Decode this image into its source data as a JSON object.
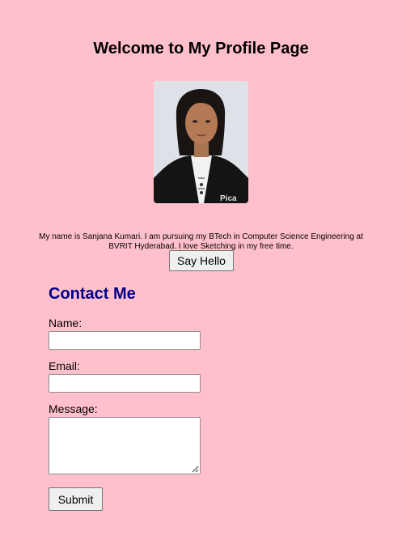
{
  "header": {
    "title": "Welcome to My Profile Page"
  },
  "profile": {
    "photo_alt": "Profile photo",
    "bio": "My name is Sanjana Kumari. I am pursuing my BTech in Computer Science Engineering at BVRIT Hyderabad. I love Sketching in my free time.",
    "say_hello_label": "Say Hello"
  },
  "contact": {
    "heading": "Contact Me",
    "name_label": "Name:",
    "name_value": "",
    "email_label": "Email:",
    "email_value": "",
    "message_label": "Message:",
    "message_value": "",
    "submit_label": "Submit"
  },
  "colors": {
    "background": "#ffc0cb",
    "heading_color": "#00008b",
    "button_bg": "#efefef"
  },
  "icons": {
    "resize_handle": "textarea-resize-icon"
  }
}
